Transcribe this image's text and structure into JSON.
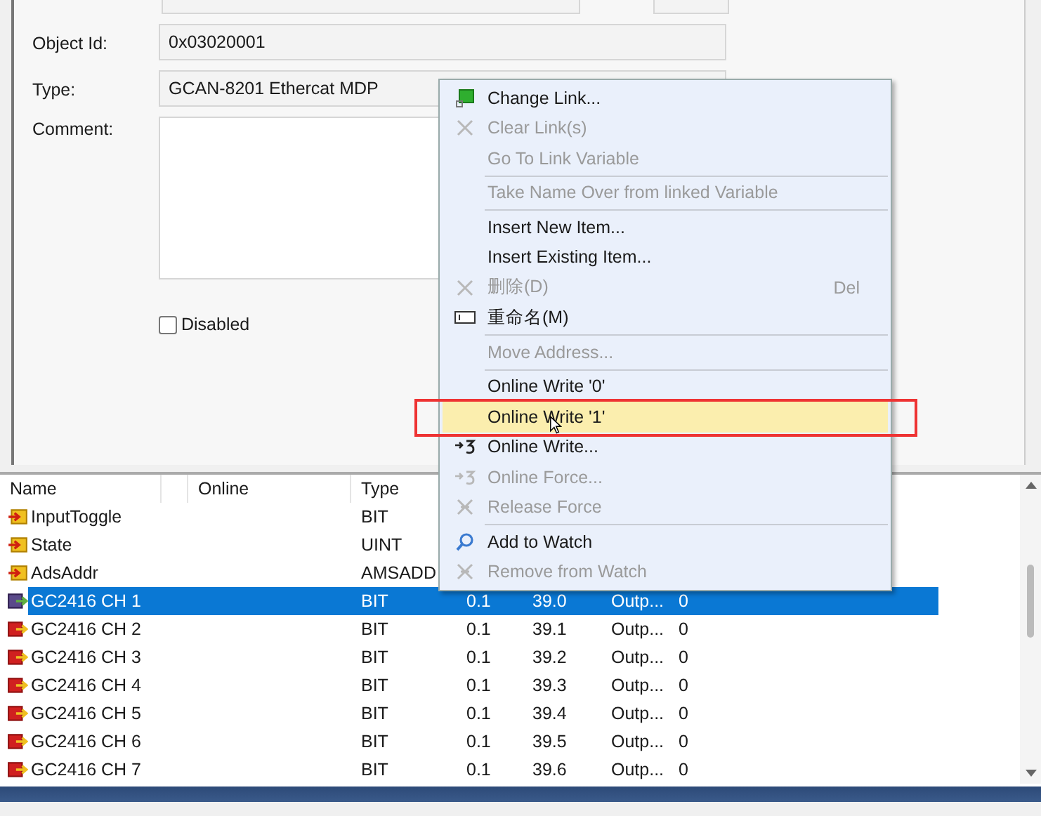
{
  "form": {
    "fields": [
      {
        "label": "Object Id:",
        "value": "0x03020001"
      },
      {
        "label": "Type:",
        "value": "GCAN-8201 Ethercat MDP"
      }
    ],
    "comment": {
      "label": "Comment:"
    },
    "disabled_checkbox": {
      "label": "Disabled",
      "checked": false
    }
  },
  "table": {
    "columns": [
      "Name",
      "Online",
      "Type"
    ],
    "rows": [
      {
        "kind": "input",
        "name": "InputToggle",
        "type": "BIT",
        "selected": false
      },
      {
        "kind": "input",
        "name": "State",
        "type": "UINT",
        "selected": false
      },
      {
        "kind": "input",
        "name": "AdsAddr",
        "type": "AMSADD",
        "selected": false
      },
      {
        "kind": "linked",
        "name": "GC2416 CH 1",
        "type": "BIT",
        "size": "0.1",
        "address": "39.0",
        "direction": "Outp...",
        "value": "0",
        "selected": true
      },
      {
        "kind": "output",
        "name": "GC2416 CH 2",
        "type": "BIT",
        "size": "0.1",
        "address": "39.1",
        "direction": "Outp...",
        "value": "0",
        "selected": false
      },
      {
        "kind": "output",
        "name": "GC2416 CH 3",
        "type": "BIT",
        "size": "0.1",
        "address": "39.2",
        "direction": "Outp...",
        "value": "0",
        "selected": false
      },
      {
        "kind": "output",
        "name": "GC2416 CH 4",
        "type": "BIT",
        "size": "0.1",
        "address": "39.3",
        "direction": "Outp...",
        "value": "0",
        "selected": false
      },
      {
        "kind": "output",
        "name": "GC2416 CH 5",
        "type": "BIT",
        "size": "0.1",
        "address": "39.4",
        "direction": "Outp...",
        "value": "0",
        "selected": false
      },
      {
        "kind": "output",
        "name": "GC2416 CH 6",
        "type": "BIT",
        "size": "0.1",
        "address": "39.5",
        "direction": "Outp...",
        "value": "0",
        "selected": false
      },
      {
        "kind": "output",
        "name": "GC2416 CH 7",
        "type": "BIT",
        "size": "0.1",
        "address": "39.6",
        "direction": "Outp...",
        "value": "0",
        "selected": false
      }
    ]
  },
  "context_menu": {
    "items": [
      {
        "kind": "link",
        "label": "Change Link...",
        "disabled": false,
        "selected": false
      },
      {
        "kind": "clear",
        "label": "Clear Link(s)",
        "disabled": true,
        "selected": false
      },
      {
        "kind": "item",
        "label": "Go To Link Variable",
        "disabled": true,
        "selected": false
      },
      {
        "kind": "separator"
      },
      {
        "kind": "item",
        "label": "Take Name Over from linked Variable",
        "disabled": true,
        "selected": false
      },
      {
        "kind": "separator"
      },
      {
        "kind": "item",
        "label": "Insert New Item...",
        "disabled": false,
        "selected": false
      },
      {
        "kind": "item",
        "label": "Insert Existing Item...",
        "disabled": false,
        "selected": false
      },
      {
        "kind": "delete",
        "label": "删除(D)",
        "shortcut": "Del",
        "disabled": true,
        "selected": false
      },
      {
        "kind": "rename",
        "label": "重命名(M)",
        "disabled": false,
        "selected": false
      },
      {
        "kind": "separator"
      },
      {
        "kind": "item",
        "label": "Move Address...",
        "disabled": true,
        "selected": false
      },
      {
        "kind": "separator"
      },
      {
        "kind": "item",
        "label": "Online Write '0'",
        "disabled": false,
        "selected": false
      },
      {
        "kind": "item",
        "label": "Online Write '1'",
        "disabled": false,
        "selected": true
      },
      {
        "kind": "write",
        "label": "Online Write...",
        "disabled": false,
        "selected": false
      },
      {
        "kind": "write",
        "label": "Online Force...",
        "disabled": true,
        "selected": false
      },
      {
        "kind": "release",
        "label": "Release Force",
        "disabled": true,
        "selected": false
      },
      {
        "kind": "separator"
      },
      {
        "kind": "watch",
        "label": "Add to Watch",
        "disabled": false,
        "selected": false
      },
      {
        "kind": "release",
        "label": "Remove from Watch",
        "disabled": true,
        "selected": false
      }
    ]
  }
}
